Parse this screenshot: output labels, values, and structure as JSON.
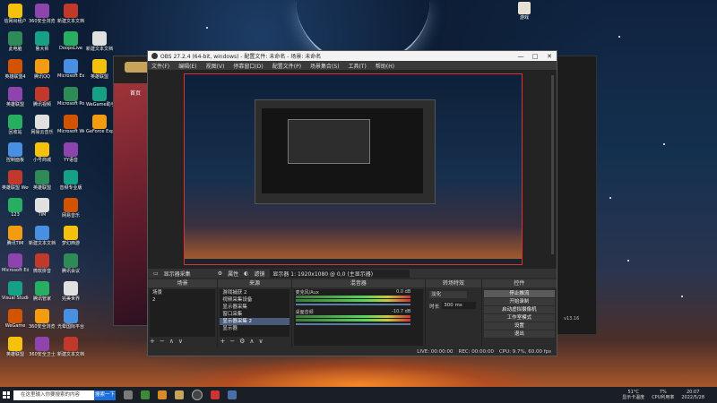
{
  "obs": {
    "title": "OBS 27.2.4 (64-bit, windows) - 配置文件: 未命名 - 场景: 未命名",
    "menu": [
      "文件(F)",
      "编辑(E)",
      "视图(V)",
      "停靠窗口(D)",
      "配置文件(P)",
      "场景集合(S)",
      "工具(T)",
      "帮助(H)"
    ],
    "info_source": "显示器采集",
    "info_props": "属性",
    "info_filters": "滤镜",
    "info_display": "显示器 1: 1920x1080 @ 0,0 (主显示器)",
    "docks": {
      "scenes": {
        "title": "场景",
        "items": [
          "场景",
          "2"
        ]
      },
      "sources": {
        "title": "来源",
        "items": [
          "游戏捕获 2",
          "视频采集设备",
          "显示器采集",
          "窗口采集",
          "显示器采集 2",
          "显示器"
        ]
      },
      "mixer": {
        "title": "混音器",
        "ch1": "麦克风/Aux",
        "ch1_db": "0.0 dB",
        "ch2": "桌面音频",
        "ch2_db": "-10.7 dB"
      },
      "transitions": {
        "title": "转场特效",
        "type": "淡化",
        "duration_label": "时长",
        "duration": "300 ms"
      },
      "controls": {
        "title": "控件",
        "buttons": [
          "停止推流",
          "开始录制",
          "启动虚拟摄像机",
          "工作室模式",
          "设置",
          "退出"
        ]
      }
    },
    "status": {
      "live": "LIVE: 00:00:00",
      "rec": "REC: 00:00:00",
      "cpu": "CPU: 9.7%, 60.00 fps"
    }
  },
  "desktop_icons": [
    "信网出租户",
    "360安全浏览器",
    "新建文本文档",
    "此电脑",
    "鲁大师",
    "DoopsLive",
    "新建文本文档",
    "英雄联盟4",
    "腾讯QQ",
    "Microsoft Excel 2010",
    "英雄联盟",
    "英雄联盟",
    "腾讯视频",
    "Microsoft PowerPoint",
    "WeGame助手",
    "回收站",
    "网易云音乐",
    "Microsoft Word 2010",
    "GeForce Experience",
    "控制面板",
    "小号商城",
    "YY语音",
    "英雄联盟 WeGame版",
    "英雄联盟",
    "音频专业版",
    "123",
    "TIM",
    "网易音乐",
    "腾讯TIM",
    "新建文本文档",
    "梦幻西游",
    "Microsoft Edge",
    "微软拼音",
    "腾讯会议",
    "Visual Studio",
    "腾讯管家",
    "完美世界",
    "WeGame",
    "360安全浏览器",
    "光晕国际平台",
    "英雄联盟",
    "360安全卫士",
    "新建文本文档"
  ],
  "taskbar": {
    "search_placeholder": "在这里输入你要搜索的内容",
    "search_button": "搜索一下",
    "weather": "51°C",
    "weather_sub": "显示卡温度",
    "cpu": "7%",
    "cpu_label": "CPU利用率",
    "time": "20:07",
    "date": "2022/5/28"
  },
  "bg_window": {
    "home": "首页",
    "version": "v13.16"
  },
  "top_right_icon_label": "游戏"
}
